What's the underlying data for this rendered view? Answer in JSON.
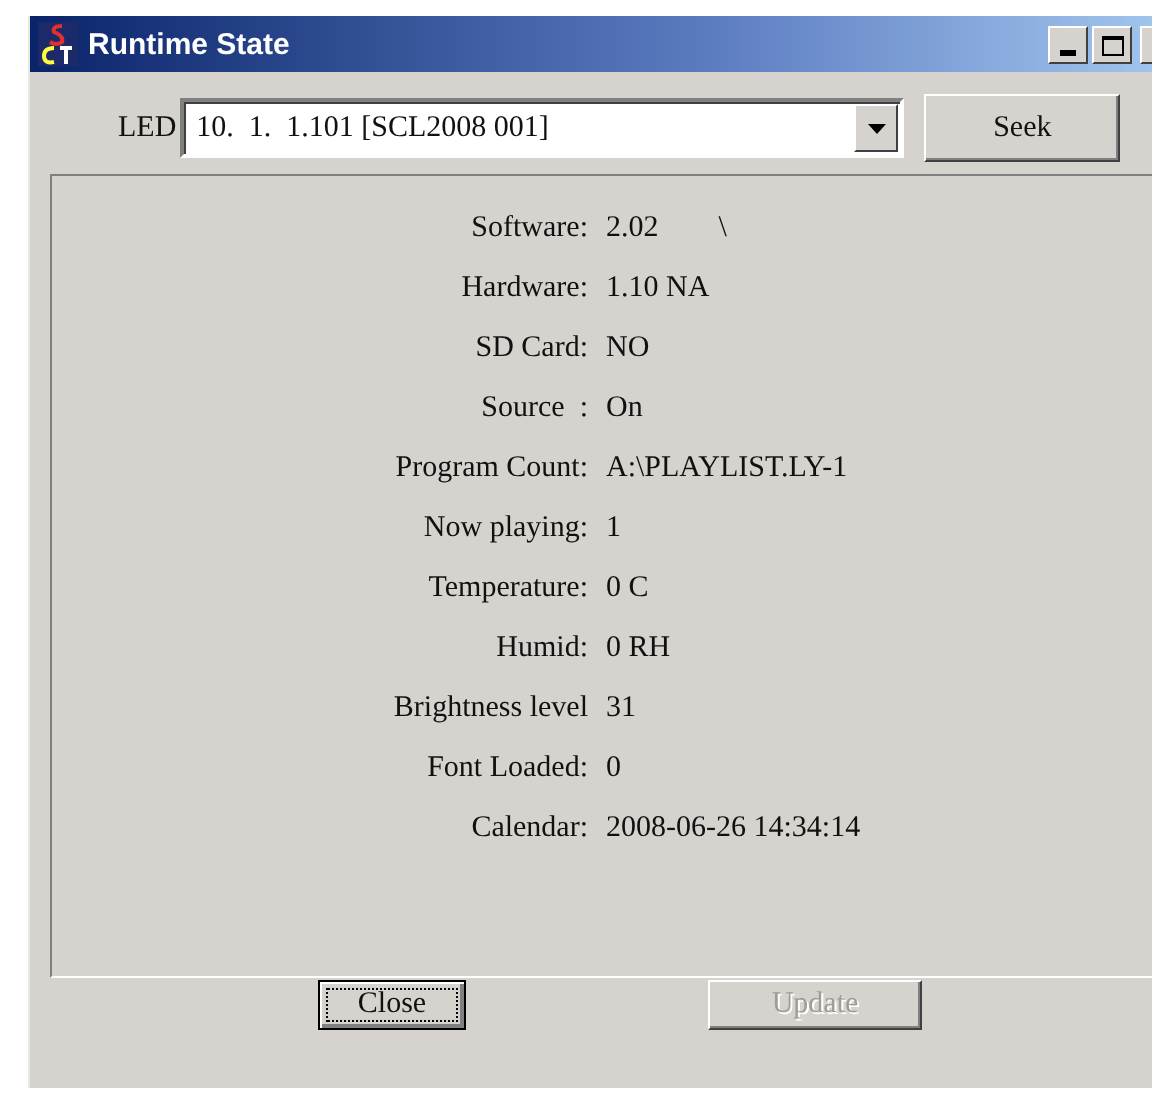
{
  "window": {
    "title": "Runtime State"
  },
  "led": {
    "label": "LED",
    "value": "10.  1.  1.101 [SCL2008 001]"
  },
  "seek_button": "Seek",
  "fields": [
    {
      "label": "Software:",
      "value": "2.02        \\"
    },
    {
      "label": "Hardware:",
      "value": "1.10 NA"
    },
    {
      "label": "SD Card:",
      "value": "NO"
    },
    {
      "label": "Source  :",
      "value": "On"
    },
    {
      "label": "Program Count:",
      "value": "A:\\PLAYLIST.LY-1"
    },
    {
      "label": "Now playing:",
      "value": "1"
    },
    {
      "label": "Temperature:",
      "value": "0 C"
    },
    {
      "label": "Humid:",
      "value": "0 RH"
    },
    {
      "label": "Brightness level",
      "value": "31"
    },
    {
      "label": "Font Loaded:",
      "value": "0"
    },
    {
      "label": "Calendar:",
      "value": "2008-06-26 14:34:14"
    }
  ],
  "buttons": [
    {
      "label": "Close",
      "disabled": false,
      "focused": true
    },
    {
      "label": "Update",
      "disabled": true,
      "focused": false
    }
  ]
}
